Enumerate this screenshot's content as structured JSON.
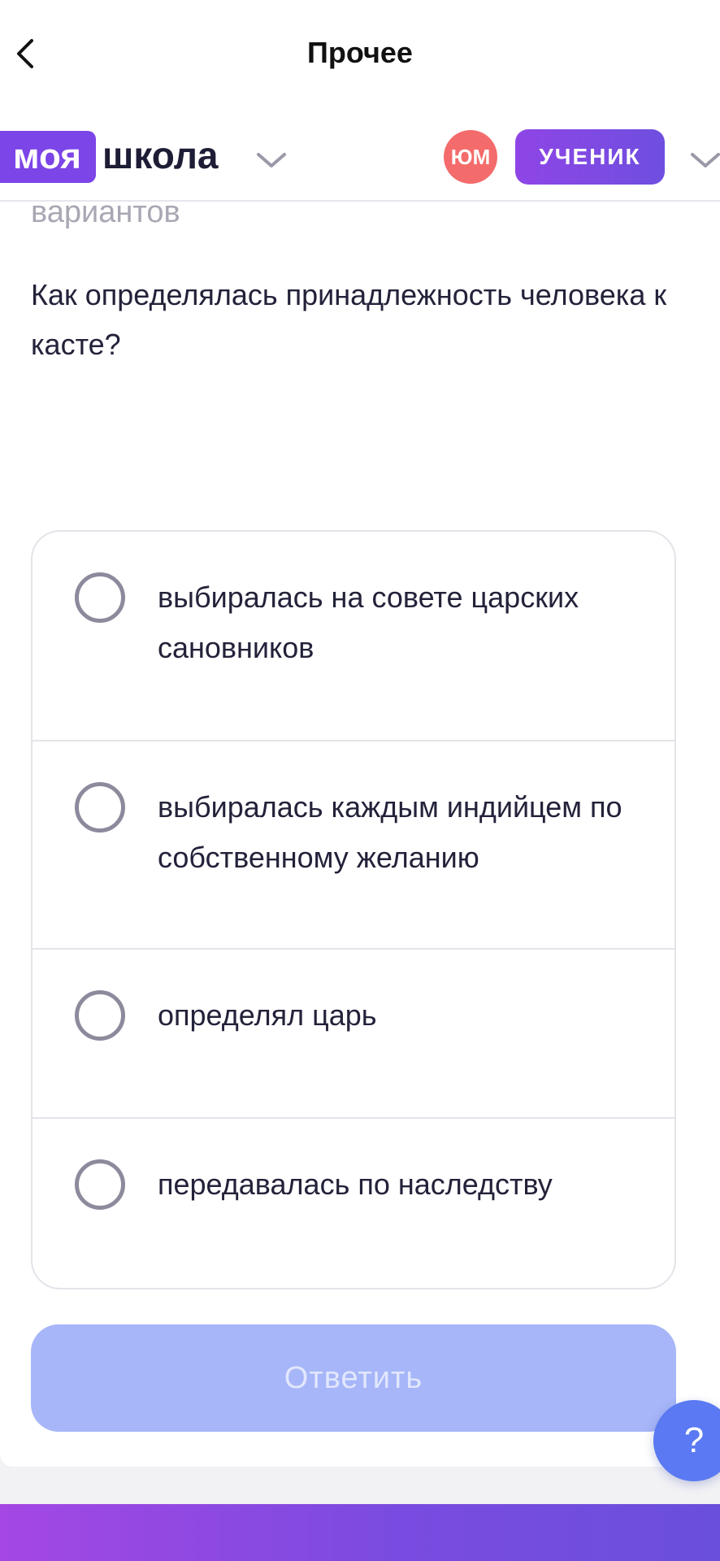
{
  "nav": {
    "title": "Прочее"
  },
  "header": {
    "logo_badge": "моя",
    "logo_text": "школа",
    "avatar_initials": "ЮМ",
    "role": "УЧЕНИК"
  },
  "task": {
    "hint": "вариантов",
    "question": "Как определялась принадлежность человека к касте?",
    "options": [
      {
        "label": "выбиралась на совете царских сановников",
        "selected": false
      },
      {
        "label": "выбиралась каждым индийцем по собственному желанию",
        "selected": false
      },
      {
        "label": "определял царь",
        "selected": false
      },
      {
        "label": "передавалась по наследству",
        "selected": false
      }
    ],
    "submit_label": "Ответить"
  },
  "help": {
    "label": "?"
  },
  "colors": {
    "brand_purple": "#7b45e8",
    "avatar_red": "#f46b6b",
    "submit_disabled": "#a6b6f8",
    "help_blue": "#5a79f2"
  }
}
